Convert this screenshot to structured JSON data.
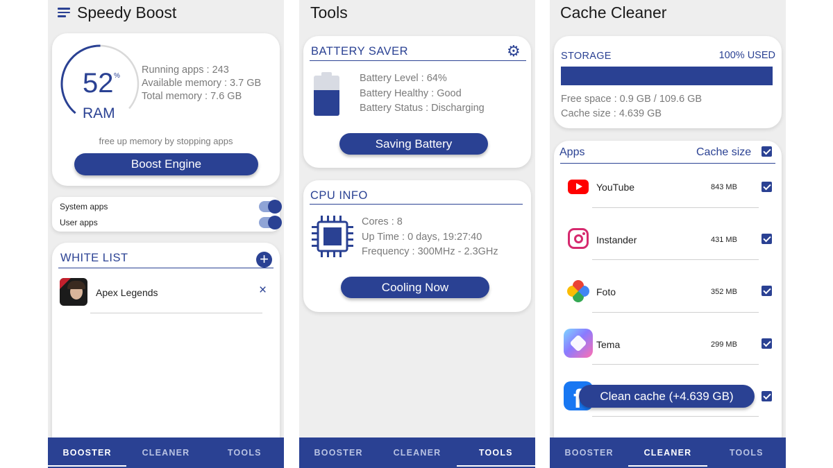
{
  "screens": {
    "booster": {
      "title": "Speedy Boost",
      "ram": {
        "percent": "52",
        "percent_sign": "%",
        "label": "RAM",
        "fill": 0.52
      },
      "stats": [
        "Running apps : 243",
        "Available memory : 3.7 GB",
        "Total memory : 7.6 GB"
      ],
      "hint": "free up memory by stopping apps",
      "boost_button": "Boost Engine",
      "toggles": [
        {
          "label": "System apps",
          "on": true
        },
        {
          "label": "User apps",
          "on": true
        }
      ],
      "whitelist": {
        "title": "WHITE LIST",
        "items": [
          {
            "name": "Apex Legends"
          }
        ]
      },
      "tabs": [
        "BOOSTER",
        "CLEANER",
        "TOOLS"
      ],
      "active_tab": 0
    },
    "tools": {
      "title": "Tools",
      "battery": {
        "title": "BATTERY SAVER",
        "lines": [
          "Battery Level : 64%",
          "Battery Healthy : Good",
          "Battery Status :  Discharging"
        ],
        "level": 0.64,
        "button": "Saving Battery"
      },
      "cpu": {
        "title": "CPU INFO",
        "lines": [
          "Cores : 8",
          "Up Time :  0 days, 19:27:40",
          "Frequency : 300MHz - 2.3GHz"
        ],
        "button": "Cooling Now"
      },
      "tabs": [
        "BOOSTER",
        "CLEANER",
        "TOOLS"
      ],
      "active_tab": 2
    },
    "cleaner": {
      "title": "Cache Cleaner",
      "storage": {
        "label": "STORAGE",
        "used_label": "100% USED",
        "used_fraction": 1.0,
        "free": "Free space : 0.9 GB / 109.6 GB",
        "cache": "Cache size : 4.639 GB"
      },
      "list_header": {
        "apps": "Apps",
        "cache": "Cache size"
      },
      "apps": [
        {
          "name": "YouTube",
          "size": "843 MB",
          "icon": "youtube-icon"
        },
        {
          "name": "Instander",
          "size": "431 MB",
          "icon": "instagram-icon"
        },
        {
          "name": "Foto",
          "size": "352 MB",
          "icon": "photos-pinwheel-icon"
        },
        {
          "name": "Tema",
          "size": "299 MB",
          "icon": "theme-app-icon"
        },
        {
          "name": "",
          "size": "",
          "icon": "facebook-icon"
        }
      ],
      "clean_button": "Clean cache (+4.639 GB)",
      "tabs": [
        "BOOSTER",
        "CLEANER",
        "TOOLS"
      ],
      "active_tab": 1
    }
  },
  "colors": {
    "primary": "#2a4193",
    "background": "#eeeeee",
    "card": "#ffffff"
  }
}
